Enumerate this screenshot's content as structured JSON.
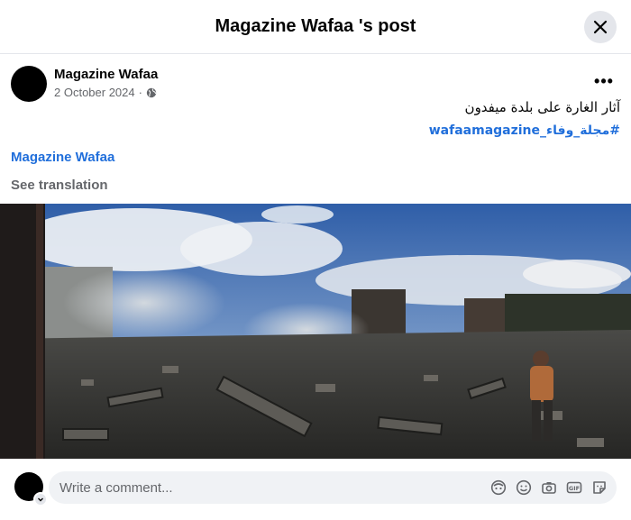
{
  "dialog": {
    "title": "Magazine Wafaa 's post"
  },
  "post": {
    "author": "Magazine Wafaa",
    "date": "2 October 2024",
    "separator": "·",
    "privacy_icon": "globe-icon",
    "more_label": "•••",
    "text": "آثار الغارة على بلدة ميفدون",
    "hashtag": "#مجلة_وفاء_wafaamagazine",
    "page_link": "Magazine Wafaa",
    "see_translation": "See translation"
  },
  "comment": {
    "placeholder": "Write a comment...",
    "icons": [
      "avatar-sticker-icon",
      "emoji-icon",
      "camera-icon",
      "gif-icon",
      "sticker-icon"
    ]
  },
  "colors": {
    "link": "#216fdb",
    "muted": "#65676b",
    "input_bg": "#f0f2f5",
    "divider": "#e4e6eb"
  }
}
